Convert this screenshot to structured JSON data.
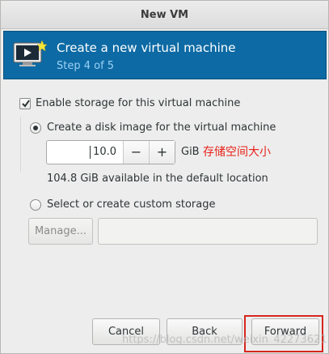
{
  "window": {
    "title": "New VM"
  },
  "header": {
    "title": "Create a new virtual machine",
    "step": "Step 4 of 5",
    "icon": "vm-monitor-icon"
  },
  "storage": {
    "enable_label": "Enable storage for this virtual machine",
    "enable_checked": true,
    "create_disk_label": "Create a disk image for the virtual machine",
    "create_disk_selected": true,
    "disk_size_value": "10.0",
    "decrement_label": "−",
    "increment_label": "+",
    "unit": "GiB",
    "annotation": "存储空间大小",
    "available_text": "104.8 GiB available in the default location",
    "custom_label": "Select or create custom storage",
    "custom_selected": false,
    "manage_label": "Manage...",
    "custom_path_value": ""
  },
  "buttons": {
    "cancel": "Cancel",
    "back": "Back",
    "forward": "Forward"
  },
  "watermark": "https://blog.csdn.net/weixin_42273621",
  "colors": {
    "header_bg": "#0d6aa4",
    "step_text": "#9ad1f5",
    "annotation": "#e8231a",
    "highlight_box": "#d6261d"
  }
}
